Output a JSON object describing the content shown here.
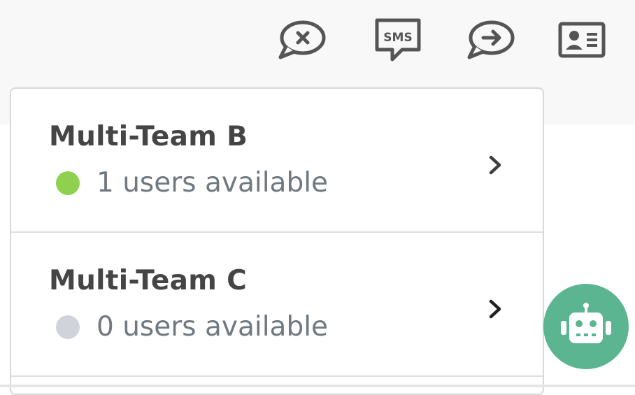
{
  "toolbar": {
    "icons": [
      {
        "name": "end-chat-icon"
      },
      {
        "name": "sms-icon",
        "label": "SMS"
      },
      {
        "name": "transfer-chat-icon"
      },
      {
        "name": "contact-card-icon"
      }
    ]
  },
  "teams": [
    {
      "name": "Multi-Team B",
      "status": "1 users available",
      "available_count": 1,
      "status_color": "#8fd14f"
    },
    {
      "name": "Multi-Team C",
      "status": "0 users available",
      "available_count": 0,
      "status_color": "#d0d4da"
    }
  ],
  "colors": {
    "icon": "#555555",
    "bot_button": "#5bb591",
    "available": "#8fd14f",
    "unavailable": "#d0d4da"
  },
  "chatbot_button": {
    "icon": "robot-icon"
  }
}
